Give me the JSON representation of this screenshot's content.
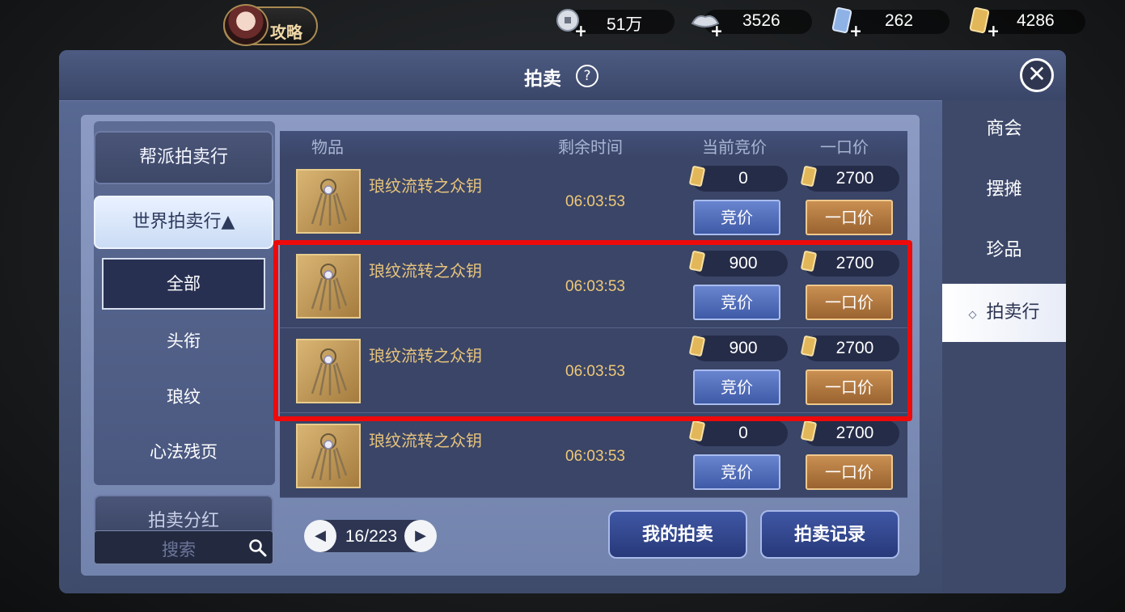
{
  "top_bar": {
    "guide_label": "攻略",
    "currencies": [
      {
        "icon": "silver-coin-icon",
        "value": "51万"
      },
      {
        "icon": "silver-ingot-icon",
        "value": "3526"
      },
      {
        "icon": "blue-ticket-icon",
        "value": "262"
      },
      {
        "icon": "gold-ticket-icon",
        "value": "4286"
      }
    ],
    "plus_symbol": "+"
  },
  "window": {
    "title": "拍卖",
    "help": "?",
    "close": "✕"
  },
  "right_tabs": [
    {
      "label": "商会",
      "active": false
    },
    {
      "label": "摆摊",
      "active": false
    },
    {
      "label": "珍品",
      "active": false
    },
    {
      "label": "拍卖行",
      "active": true
    }
  ],
  "left_nav": {
    "guild_auction": "帮派拍卖行",
    "world_auction": "世界拍卖行▲",
    "sub_items": [
      "全部",
      "头衔",
      "琅纹",
      "心法残页"
    ],
    "dividend": "拍卖分红",
    "search_placeholder": "搜索"
  },
  "table": {
    "headers": {
      "item": "物品",
      "time": "剩余时间",
      "bid": "当前竞价",
      "buyout": "一口价"
    },
    "bid_button": "竞价",
    "buyout_button": "一口价",
    "rows": [
      {
        "name": "琅纹流转之众钥",
        "time": "06:03:53",
        "current_bid": "0",
        "buyout": "2700"
      },
      {
        "name": "琅纹流转之众钥",
        "time": "06:03:53",
        "current_bid": "900",
        "buyout": "2700"
      },
      {
        "name": "琅纹流转之众钥",
        "time": "06:03:53",
        "current_bid": "900",
        "buyout": "2700"
      },
      {
        "name": "琅纹流转之众钥",
        "time": "06:03:53",
        "current_bid": "0",
        "buyout": "2700"
      }
    ]
  },
  "pagination": {
    "text": "16/223"
  },
  "actions": {
    "my_auction": "我的拍卖",
    "auction_record": "拍卖记录"
  },
  "colors": {
    "highlight": "#ee0a0a",
    "gold_text": "#e8c47c",
    "time_text": "#f0c978"
  }
}
